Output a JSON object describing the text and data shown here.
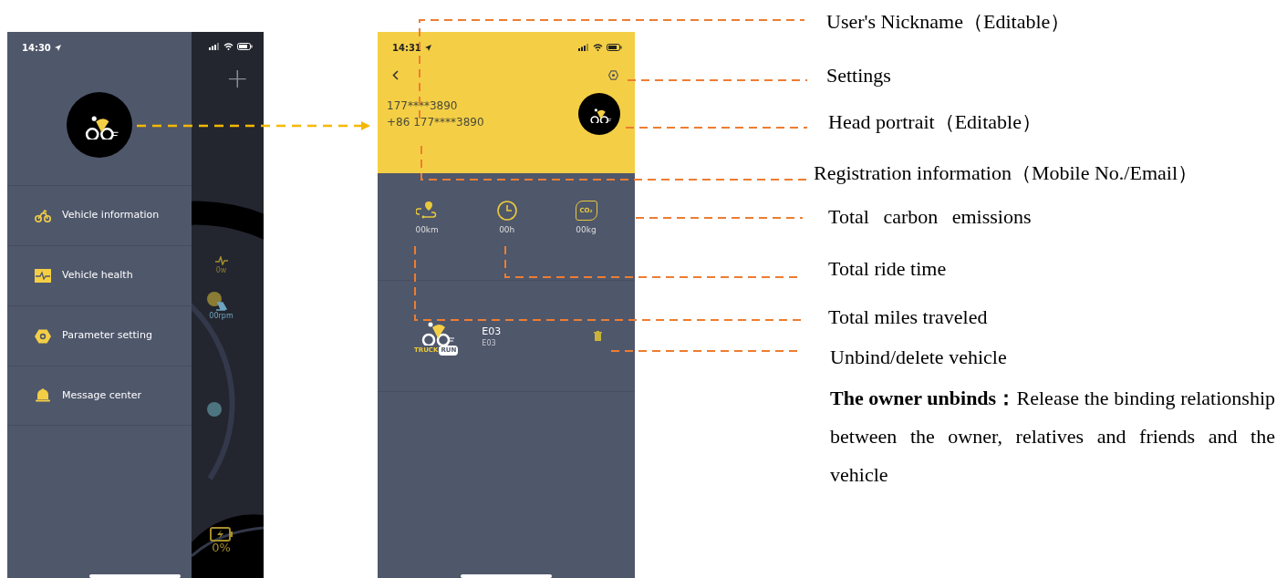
{
  "left_phone": {
    "status_time": "14:30",
    "add_button": "+",
    "menu": [
      {
        "label": "Vehicle information",
        "kind": "bike"
      },
      {
        "label": "Vehicle health",
        "kind": "health"
      },
      {
        "label": "Parameter setting",
        "kind": "settings"
      },
      {
        "label": "Message center",
        "kind": "bell"
      }
    ],
    "gauges": {
      "power": "0w",
      "cadence": "00rpm",
      "battery": "0%"
    }
  },
  "right_phone": {
    "status_time": "14:31",
    "account": "177****3890",
    "registration": "+86 177****3890",
    "stats": [
      {
        "value": "00km",
        "kind": "distance"
      },
      {
        "value": "00h",
        "kind": "time"
      },
      {
        "value": "00kg",
        "kind": "carbon",
        "icon_label": "CO₂"
      }
    ],
    "vehicle": {
      "logo_text": [
        "TRUCK",
        "RUN"
      ],
      "name": "E03",
      "model": "E03"
    }
  },
  "annotations": [
    {
      "text": "User's Nickname（Editable）"
    },
    {
      "text": "Settings"
    },
    {
      "text": "Head portrait（Editable）"
    },
    {
      "text": "Registration information（Mobile No./Email）"
    },
    {
      "text": "Total carbon emissions"
    },
    {
      "text": "Total ride time"
    },
    {
      "text": "Total miles traveled"
    },
    {
      "text": "Unbind/delete vehicle"
    }
  ],
  "note": "**The owner unbinds：**Release the binding relationship between the owner, relatives and friends and the vehicle"
}
